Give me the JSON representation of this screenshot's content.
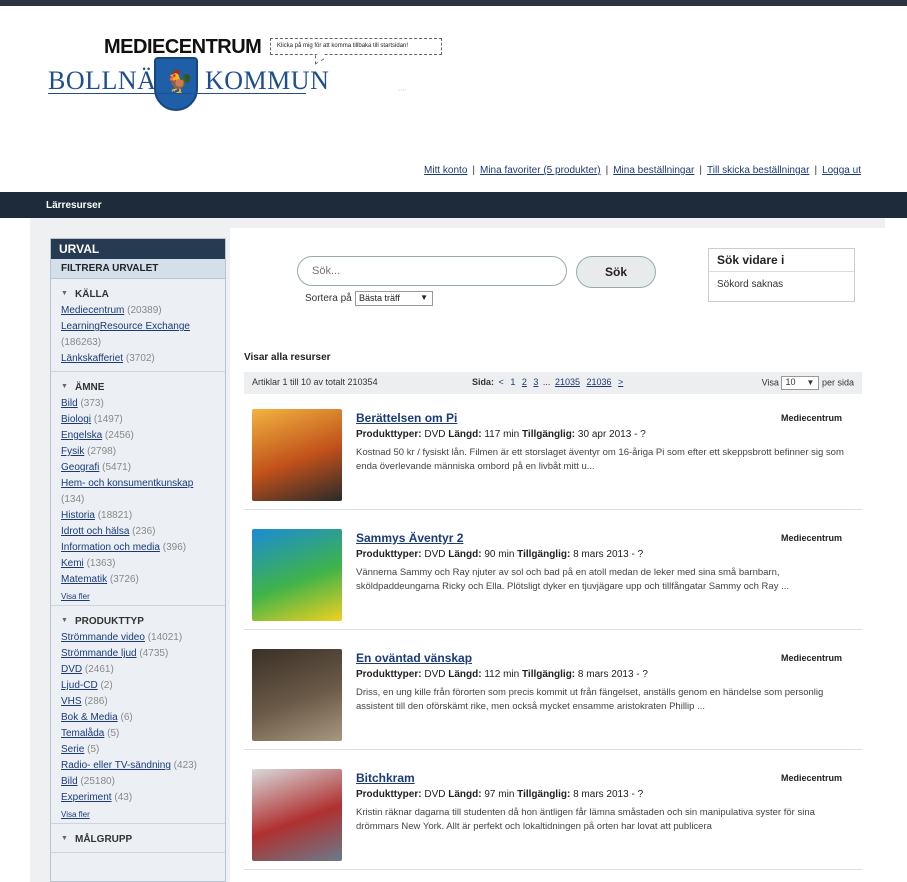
{
  "header": {
    "brand_top": "MEDIECENTRUM",
    "tooltip": "Klicka på mig för att komma tillbaka till startsidan!",
    "logo_left": "BOLLNÄS",
    "logo_right": "KOMMUN",
    "faint_text": "ᐧᐧᐧᐧ"
  },
  "user_links": [
    "Mitt konto",
    "Mina favoriter (5 produkter)",
    "Mina beställningar",
    "Till skicka beställningar",
    "Logga ut"
  ],
  "navbar": {
    "title": "Lärresurser"
  },
  "sidebar": {
    "heading": "URVAL",
    "subheading": "FILTRERA URVALET",
    "sections": [
      {
        "title": "KÄLLA",
        "items": [
          {
            "label": "Mediecentrum",
            "count": "(20389)"
          },
          {
            "label": "LearningResource Exchange",
            "count": "(186263)"
          },
          {
            "label": "Länkskafferiet",
            "count": "(3702)"
          }
        ]
      },
      {
        "title": "ÄMNE",
        "items": [
          {
            "label": "Bild",
            "count": "(373)"
          },
          {
            "label": "Biologi",
            "count": "(1497)"
          },
          {
            "label": "Engelska",
            "count": "(2456)"
          },
          {
            "label": "Fysik",
            "count": "(2798)"
          },
          {
            "label": "Geografi",
            "count": "(5471)"
          },
          {
            "label": "Hem- och konsumentkunskap",
            "count": "(134)"
          },
          {
            "label": "Historia",
            "count": "(18821)"
          },
          {
            "label": "Idrott och hälsa",
            "count": "(236)"
          },
          {
            "label": "Information och media",
            "count": "(396)"
          },
          {
            "label": "Kemi",
            "count": "(1363)"
          },
          {
            "label": "Matematik",
            "count": "(3726)"
          }
        ],
        "more": "Visa fler"
      },
      {
        "title": "PRODUKTTYP",
        "items": [
          {
            "label": "Strömmande video",
            "count": "(14021)"
          },
          {
            "label": "Strömmande ljud",
            "count": "(4735)"
          },
          {
            "label": "DVD",
            "count": "(2461)"
          },
          {
            "label": "Ljud-CD",
            "count": "(2)"
          },
          {
            "label": "VHS",
            "count": "(286)"
          },
          {
            "label": "Bok & Media",
            "count": "(6)"
          },
          {
            "label": "Temalåda",
            "count": "(5)"
          },
          {
            "label": "Serie",
            "count": "(5)"
          },
          {
            "label": "Radio- eller TV-sändning",
            "count": "(423)"
          },
          {
            "label": "Bild",
            "count": "(25180)"
          },
          {
            "label": "Experiment",
            "count": "(43)"
          }
        ],
        "more": "Visa fler"
      },
      {
        "title": "MÅLGRUPP",
        "items": []
      }
    ]
  },
  "search": {
    "placeholder": "Sök...",
    "button": "Sök",
    "sort_label": "Sortera på",
    "sort_value": "Bästa träff"
  },
  "further": {
    "title": "Sök vidare i",
    "body": "Sökord saknas"
  },
  "results_header": {
    "showing": "Visar alla resurser",
    "count_text": "Artiklar 1 till 10 av totalt 210354",
    "page_label": "Sida:",
    "pages": [
      "<",
      "1",
      "2",
      "3",
      "...",
      "21035",
      "21036",
      ">"
    ],
    "visa_label": "Visa",
    "per_page": "10",
    "per_label": "per sida"
  },
  "results": [
    {
      "title": "Berättelsen om Pi",
      "source": "Mediecentrum",
      "type": "DVD",
      "length": "117 min",
      "available": "30 apr 2013 - ?",
      "desc": "Kostnad 50 kr / fysiskt lån. Filmen är ett storslaget äventyr om 16-åriga Pi som efter ett skeppsbrott befinner sig som enda överlevande människa ombord på en livbåt mitt u...",
      "poster_colors": [
        "#f2b440",
        "#c0501a",
        "#2a2a2a"
      ]
    },
    {
      "title": "Sammys Äventyr 2",
      "source": "Mediecentrum",
      "type": "DVD",
      "length": "90 min",
      "available": "8 mars 2013 - ?",
      "desc": "Vännerna Sammy och Ray njuter av sol och bad på en atoll medan de leker med sina små barnbarn, sköldpaddeungarna Ricky och Ella. Plötsligt dyker en tjuvjägare upp och tillfångatar Sammy och Ray ...",
      "poster_colors": [
        "#1b8bd6",
        "#3fb34a",
        "#f0d020"
      ]
    },
    {
      "title": "En oväntad vänskap",
      "source": "Mediecentrum",
      "type": "DVD",
      "length": "112 min",
      "available": "8 mars 2013 - ?",
      "desc": "Driss, en ung kille från förorten som precis kommit ut från fängelset, anställs genom en händelse som personlig assistent till den oförskämt rike, men också mycket ensamme aristokraten Phillip ...",
      "poster_colors": [
        "#3a3026",
        "#6b5a48",
        "#a89880"
      ]
    },
    {
      "title": "Bitchkram",
      "source": "Mediecentrum",
      "type": "DVD",
      "length": "97 min",
      "available": "8 mars 2013 - ?",
      "desc": "Kristin räknar dagarna till studenten då hon äntligen får lämna småstaden och sin manipulativa syster för sina drömmars New York. Allt är perfekt och lokaltidningen på orten har lovat att publicera",
      "poster_colors": [
        "#d8dadc",
        "#b03030",
        "#6a7a8a"
      ]
    }
  ],
  "meta_labels": {
    "type": "Produkttyper:",
    "length": "Längd:",
    "available": "Tillgänglig:"
  }
}
